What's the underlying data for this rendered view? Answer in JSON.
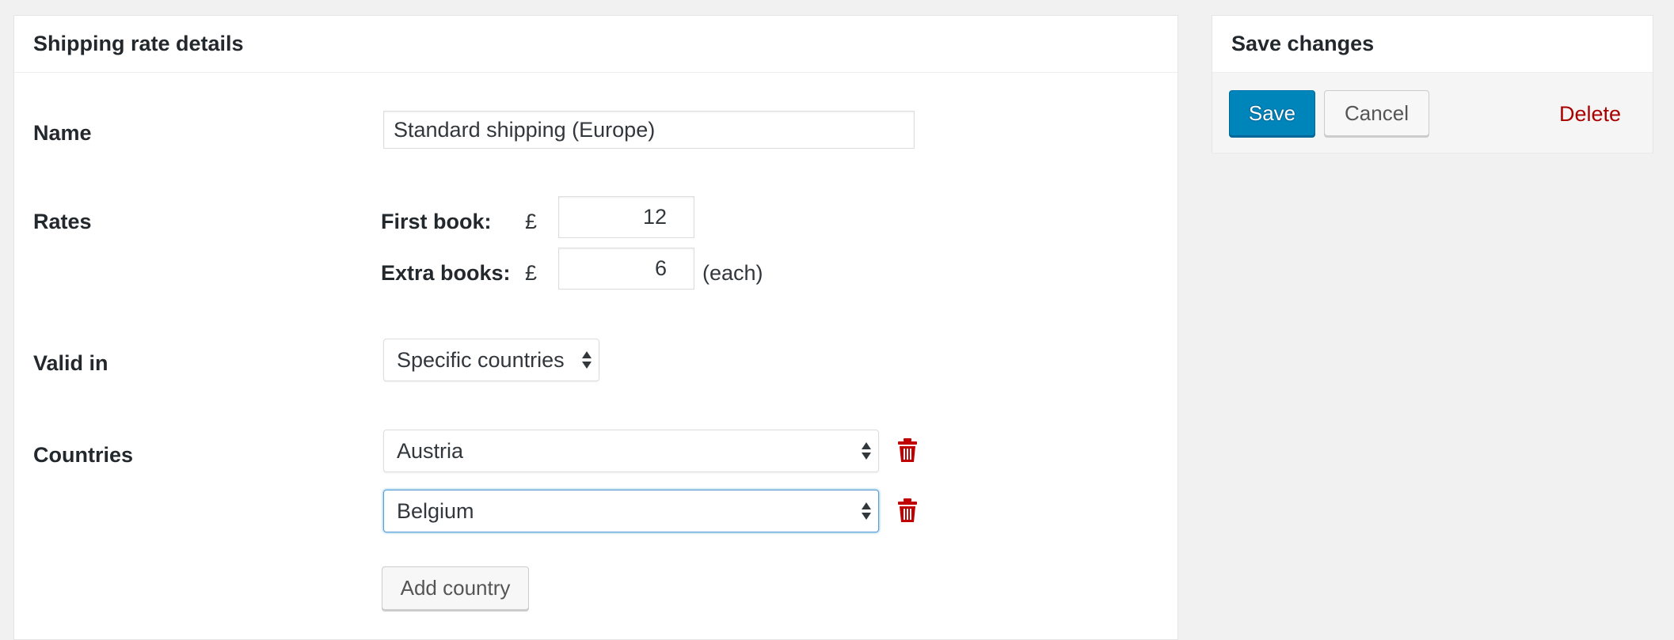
{
  "main_panel": {
    "title": "Shipping rate details",
    "name_row": {
      "label": "Name",
      "value": "Standard shipping (Europe)"
    },
    "rates_row": {
      "label": "Rates",
      "first_book_label": "First book:",
      "extra_books_label": "Extra books:",
      "currency_symbol": "£",
      "first_book_value": "12",
      "extra_books_value": "6",
      "each_note": "(each)"
    },
    "valid_in_row": {
      "label": "Valid in",
      "selected": "Specific countries"
    },
    "countries_row": {
      "label": "Countries",
      "countries": [
        "Austria",
        "Belgium"
      ],
      "add_button_label": "Add country"
    }
  },
  "side_panel": {
    "title": "Save changes",
    "save_label": "Save",
    "cancel_label": "Cancel",
    "delete_label": "Delete"
  },
  "colors": {
    "primary_button": "#0085ba",
    "delete_link": "#aa0000",
    "trash_icon": "#c00000",
    "focus_border": "#5b9dd9"
  },
  "icons": {
    "select_arrows": "select-arrows-icon",
    "remove_country": "trash-icon"
  }
}
